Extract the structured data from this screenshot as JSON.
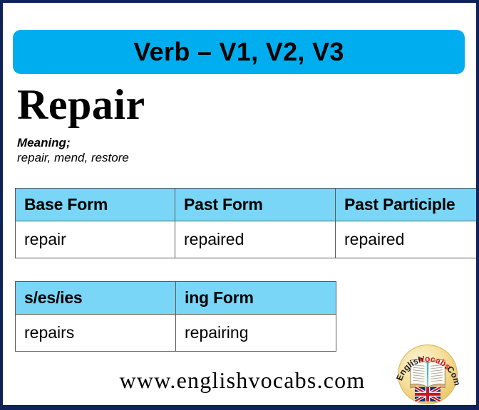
{
  "card": {
    "border_color": "#0d2359",
    "background": "#ffffff"
  },
  "banner": {
    "title": "Verb – V1, V2, V3",
    "background_color": "#00AEEF",
    "text_color": "#000000"
  },
  "headword": {
    "word": "Repair"
  },
  "meaning": {
    "label": "Meaning;",
    "text": "repair, mend, restore"
  },
  "tables": [
    {
      "name": "verb-forms-table",
      "header_background": "#79D6F7",
      "headers": [
        "Base Form",
        "Past Form",
        "Past Participle"
      ],
      "rows": [
        [
          "repair",
          "repaired",
          "repaired"
        ]
      ]
    },
    {
      "name": "s-ing-forms-table",
      "header_background": "#79D6F7",
      "headers": [
        "s/es/ies",
        "ing Form"
      ],
      "rows": [
        [
          "repairs",
          "repairing"
        ]
      ]
    }
  ],
  "footer": {
    "url": "www.englishvocabs.com"
  },
  "logo": {
    "text_english": "English",
    "text_vocabs": "Vocabs",
    "text_com": ".Com",
    "english_color": "#1a1a1a",
    "vocabs_color": "#d81d1d",
    "com_color": "#1a1a1a",
    "circle_fill": "#f2d98b",
    "icons": [
      "open-book-icon",
      "uk-flag-icon"
    ]
  }
}
